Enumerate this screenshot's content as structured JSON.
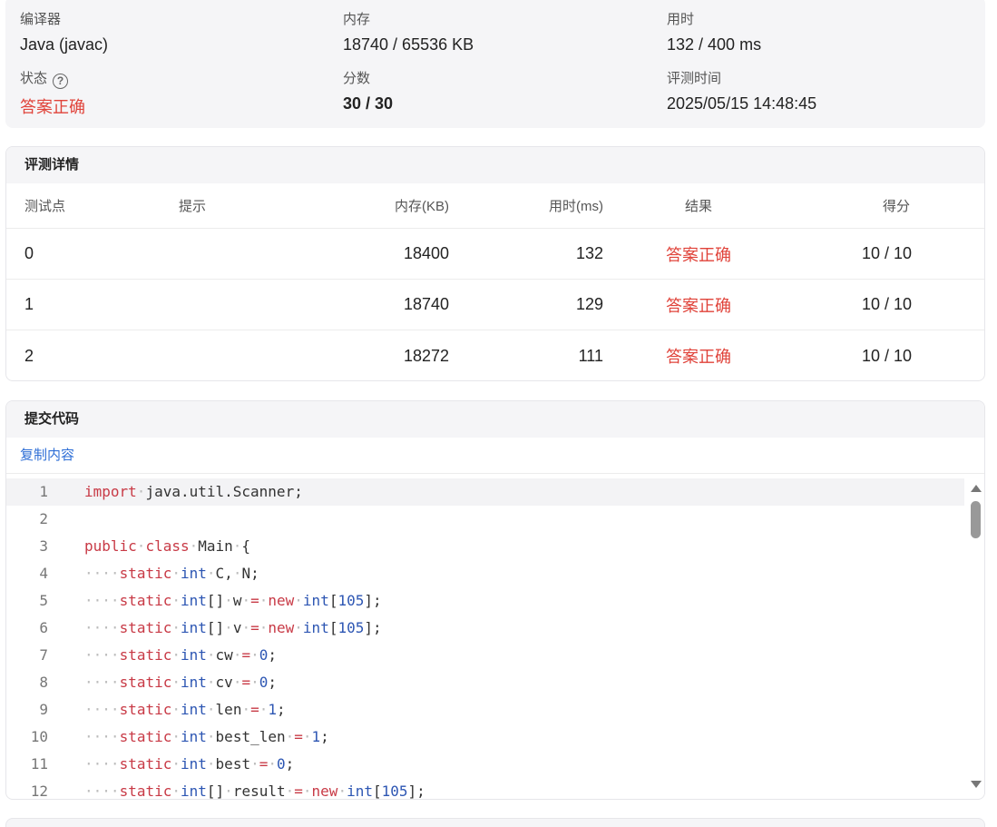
{
  "summary": {
    "compiler_label": "编译器",
    "compiler_value": "Java (javac)",
    "memory_label": "内存",
    "memory_value": "18740 / 65536 KB",
    "time_label": "用时",
    "time_value": "132 / 400 ms",
    "status_label": "状态",
    "status_help": "?",
    "status_value": "答案正确",
    "score_label": "分数",
    "score_value": "30 / 30",
    "judge_time_label": "评测时间",
    "judge_time_value": "2025/05/15 14:48:45"
  },
  "judge_detail": {
    "title": "评测详情",
    "headers": {
      "id": "测试点",
      "hint": "提示",
      "memory": "内存(KB)",
      "time": "用时(ms)",
      "result": "结果",
      "score": "得分"
    },
    "rows": [
      {
        "id": "0",
        "hint": "",
        "memory": "18400",
        "time": "132",
        "result": "答案正确",
        "score": "10 / 10"
      },
      {
        "id": "1",
        "hint": "",
        "memory": "18740",
        "time": "129",
        "result": "答案正确",
        "score": "10 / 10"
      },
      {
        "id": "2",
        "hint": "",
        "memory": "18272",
        "time": "111",
        "result": "答案正确",
        "score": "10 / 10"
      }
    ]
  },
  "code": {
    "title": "提交代码",
    "copy_label": "复制内容",
    "lines": [
      {
        "n": "1",
        "text": "import java.util.Scanner;"
      },
      {
        "n": "2",
        "text": ""
      },
      {
        "n": "3",
        "text": "public class Main {"
      },
      {
        "n": "4",
        "text": "    static int C, N;"
      },
      {
        "n": "5",
        "text": "    static int[] w = new int[105];"
      },
      {
        "n": "6",
        "text": "    static int[] v = new int[105];"
      },
      {
        "n": "7",
        "text": "    static int cw = 0;"
      },
      {
        "n": "8",
        "text": "    static int cv = 0;"
      },
      {
        "n": "9",
        "text": "    static int len = 1;"
      },
      {
        "n": "10",
        "text": "    static int best_len = 1;"
      },
      {
        "n": "11",
        "text": "    static int best = 0;"
      },
      {
        "n": "12",
        "text": "    static int[] result = new int[105];"
      }
    ]
  },
  "colors": {
    "accepted": "#e0433a",
    "link": "#2f6fd6",
    "keyword": "#c83a46",
    "type": "#2d56b3"
  }
}
